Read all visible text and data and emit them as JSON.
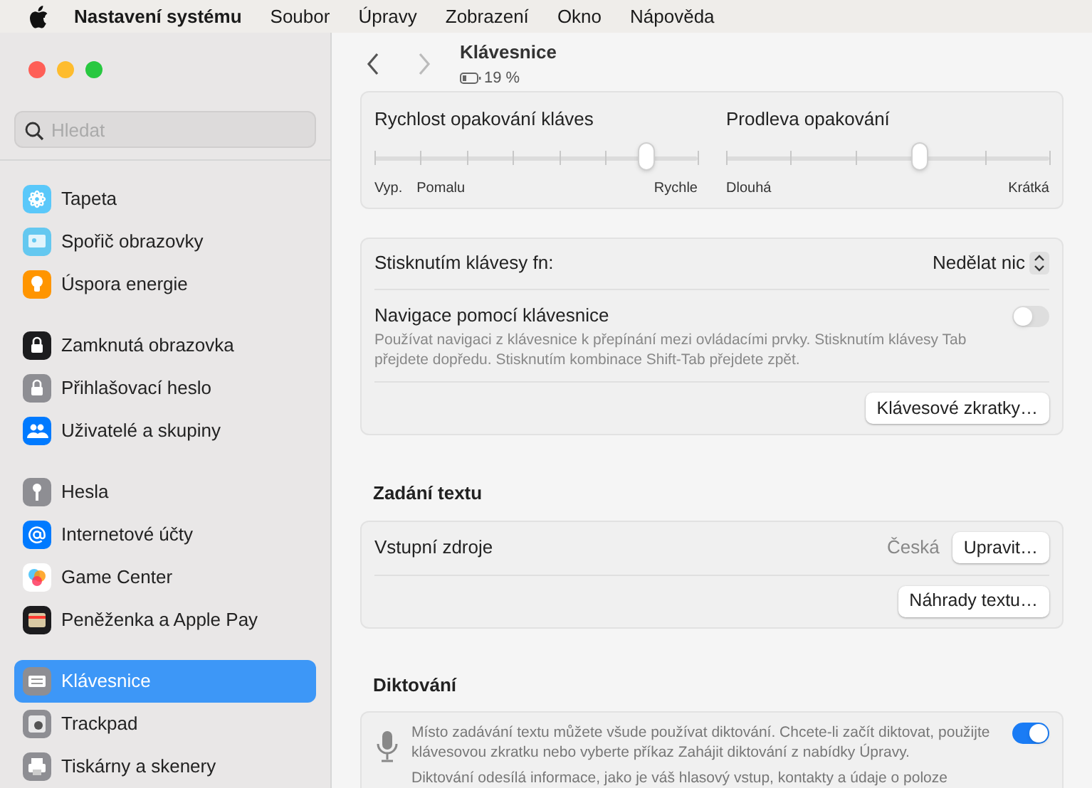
{
  "menu_bar": {
    "app": "Nastavení systému",
    "items": [
      "Soubor",
      "Úpravy",
      "Zobrazení",
      "Okno",
      "Nápověda"
    ]
  },
  "sidebar": {
    "search": {
      "placeholder": "Hledat"
    },
    "groups": [
      {
        "items": [
          {
            "label": "Tapeta",
            "kind": "flower",
            "color": "#5ac8fa",
            "selected": false
          },
          {
            "label": "Spořič obrazovky",
            "kind": "screen",
            "color": "#64c8f0",
            "selected": false
          },
          {
            "label": "Úspora energie",
            "kind": "bulb",
            "color": "#ff9500",
            "selected": false
          }
        ]
      },
      {
        "items": [
          {
            "label": "Zamknutá obrazovka",
            "kind": "lock",
            "color": "#1c1c1e",
            "selected": false
          },
          {
            "label": "Přihlašovací heslo",
            "kind": "lock",
            "color": "#8e8e93",
            "selected": false
          },
          {
            "label": "Uživatelé a skupiny",
            "kind": "users",
            "color": "#007aff",
            "selected": false
          }
        ]
      },
      {
        "items": [
          {
            "label": "Hesla",
            "kind": "key",
            "color": "#8e8e93",
            "selected": false
          },
          {
            "label": "Internetové účty",
            "kind": "at",
            "color": "#007aff",
            "selected": false
          },
          {
            "label": "Game Center",
            "kind": "bubbles",
            "color": "#ffffff",
            "selected": false
          },
          {
            "label": "Peněženka a Apple Pay",
            "kind": "wallet",
            "color": "#1c1c1e",
            "selected": false
          }
        ]
      },
      {
        "items": [
          {
            "label": "Klávesnice",
            "kind": "keyboard",
            "color": "#8e8e93",
            "selected": true
          },
          {
            "label": "Trackpad",
            "kind": "hand",
            "color": "#8e8e93",
            "selected": false
          },
          {
            "label": "Tiskárny a skenery",
            "kind": "printer",
            "color": "#8e8e93",
            "selected": false
          }
        ]
      }
    ]
  },
  "header": {
    "title": "Klávesnice",
    "battery": "19 %"
  },
  "sliders": [
    {
      "label": "Rychlost opakování kláves",
      "level": 0.84,
      "labels": [
        "Vyp.",
        "Pomalu",
        "Rychle"
      ]
    },
    {
      "label": "Prodleva opakování",
      "level": 0.6,
      "labels": [
        "Dlouhá",
        "Krátká"
      ]
    }
  ],
  "fn_row": {
    "label": "Stisknutím klávesy fn:",
    "value": "Nedělat nic"
  },
  "keyboard_navigation": {
    "label": "Navigace pomocí klávesnice",
    "description": "Používat navigaci z klávesnice k přepínání mezi ovládacími prvky. Stisknutím klávesy Tab přejdete dopředu. Stisknutím kombinace Shift-Tab přejdete zpět.",
    "on": false
  },
  "shortcuts_button": "Klávesové zkratky…",
  "text_input": {
    "heading": "Zadání textu",
    "sources_label": "Vstupní zdroje",
    "sources_value": "Česká",
    "edit_button": "Upravit…",
    "replacements_button": "Náhrady textu…"
  },
  "dictation": {
    "heading": "Diktování",
    "description": "Místo zadávání textu můžete všude používat diktování. Chcete-li začít diktovat, použijte klávesovou zkratku nebo vyberte příkaz Zahájit diktování z nabídky Úpravy.",
    "on": true,
    "note": "Diktování odesílá informace, jako je váš hlasový vstup, kontakty a údaje o poloze"
  }
}
